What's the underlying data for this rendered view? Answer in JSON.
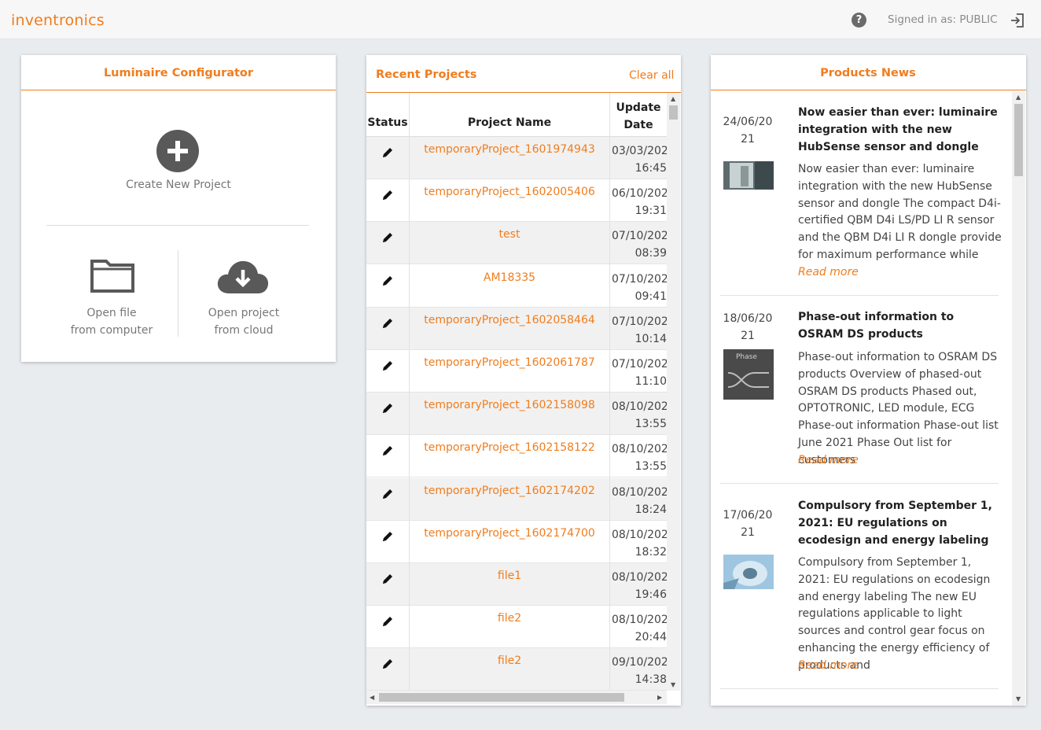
{
  "header": {
    "logo": "inventronics",
    "signed_in": "Signed in as: PUBLIC",
    "help_icon": "question-circle-icon",
    "signout_icon": "sign-out-icon"
  },
  "configurator": {
    "title": "Luminaire Configurator",
    "create_label": "Create New Project",
    "open_file_line1": "Open file",
    "open_file_line2": "from computer",
    "open_cloud_line1": "Open project",
    "open_cloud_line2": "from cloud"
  },
  "recent": {
    "title": "Recent Projects",
    "clear_all": "Clear all",
    "columns": {
      "status": "Status",
      "name": "Project Name",
      "date_line1": "Update",
      "date_line2": "Date"
    },
    "rows": [
      {
        "name": "temporaryProject_1601974943",
        "date": "03/03/202\n16:45"
      },
      {
        "name": "temporaryProject_1602005406",
        "date": "06/10/202\n19:31"
      },
      {
        "name": "test",
        "date": "07/10/202\n08:39"
      },
      {
        "name": "AM18335",
        "date": "07/10/202\n09:41"
      },
      {
        "name": "temporaryProject_1602058464",
        "date": "07/10/202\n10:14"
      },
      {
        "name": "temporaryProject_1602061787",
        "date": "07/10/202\n11:10"
      },
      {
        "name": "temporaryProject_1602158098",
        "date": "08/10/202\n13:55"
      },
      {
        "name": "temporaryProject_1602158122",
        "date": "08/10/202\n13:55"
      },
      {
        "name": "temporaryProject_1602174202",
        "date": "08/10/202\n18:24"
      },
      {
        "name": "temporaryProject_1602174700",
        "date": "08/10/202\n18:32"
      },
      {
        "name": "file1",
        "date": "08/10/202\n19:46"
      },
      {
        "name": "file2",
        "date": "08/10/202\n20:44"
      },
      {
        "name": "file2",
        "date": "09/10/202\n14:38"
      }
    ]
  },
  "news": {
    "title": "Products News",
    "read_more": "Read more",
    "items": [
      {
        "date_line1": "24/06/20",
        "date_line2": "21",
        "title": "Now easier than ever: luminaire integration with the new HubSense sensor and dongle",
        "text": "Now easier than ever: luminaire integration with the new HubSense sensor and dongle The compact D4i-certified QBM D4i LS/PD LI R sensor and the QBM D4i LI R dongle provide for maximum performance while"
      },
      {
        "date_line1": "18/06/20",
        "date_line2": "21",
        "title": "Phase-out information to OSRAM DS products",
        "thumb_label": "Phase",
        "text": "Phase-out information to OSRAM DS products Overview of phased-out OSRAM DS products Phased out, OPTOTRONIC, LED module, ECG Phase-out information Phase-out list June 2021 Phase Out list for customers"
      },
      {
        "date_line1": "17/06/20",
        "date_line2": "21",
        "title": "Compulsory from September 1, 2021: EU regulations on ecodesign and energy labeling",
        "text": "Compulsory from September 1, 2021: EU regulations on ecodesign and energy labeling The new EU regulations applicable to light sources and control gear focus on enhancing the energy efficiency of products and"
      }
    ]
  }
}
